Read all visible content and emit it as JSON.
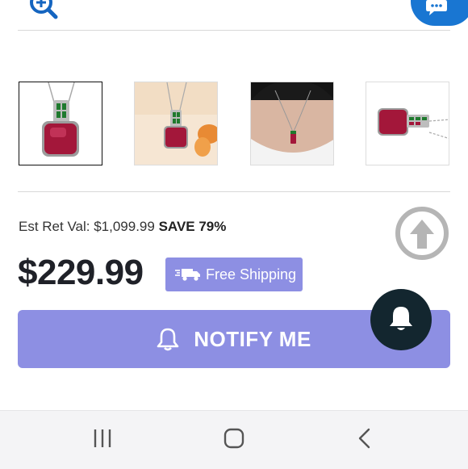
{
  "header": {
    "zoom_icon": "zoom-in-icon",
    "chat_icon": "chat-bubble-icon"
  },
  "gallery": {
    "thumbnails": [
      {
        "alt": "ruby-pendant-front",
        "selected": true
      },
      {
        "alt": "ruby-pendant-styled",
        "selected": false
      },
      {
        "alt": "ruby-pendant-worn",
        "selected": false
      },
      {
        "alt": "ruby-pendant-side",
        "selected": false
      }
    ]
  },
  "pricing": {
    "est_label": "Est Ret Val: $1,099.99",
    "save_text": "SAVE 79%",
    "price": "$229.99",
    "shipping_label": "Free Shipping",
    "shipping_icon": "truck-icon"
  },
  "actions": {
    "notify_label": "NOTIFY ME",
    "notify_icon": "bell-icon",
    "scroll_top_icon": "arrow-up-icon",
    "bell_fab_icon": "bell-icon"
  },
  "nav": {
    "recents_icon": "recent-apps-icon",
    "home_icon": "home-icon",
    "back_icon": "back-icon"
  },
  "colors": {
    "accent": "#8d8fe3",
    "fab_dark": "#13262f",
    "chat_blue": "#1976d2",
    "ruby": "#a3173a",
    "diopside": "#1f7a2e"
  }
}
